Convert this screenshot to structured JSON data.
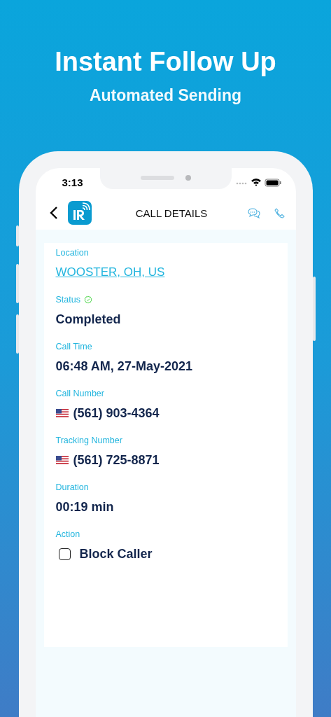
{
  "headline": "Instant Follow Up",
  "subheadline": "Automated Sending",
  "status_bar": {
    "time": "3:13"
  },
  "nav": {
    "title": "CALL DETAILS"
  },
  "fields": [
    {
      "kind": "link",
      "label": "Location",
      "value": "WOOSTER, OH, US"
    },
    {
      "kind": "status",
      "label": "Status",
      "value": "Completed"
    },
    {
      "kind": "text",
      "label": "Call Time",
      "value": "06:48 AM, 27-May-2021"
    },
    {
      "kind": "phone",
      "label": "Call Number",
      "value": "(561) 903-4364"
    },
    {
      "kind": "phone",
      "label": "Tracking Number",
      "value": "(561) 725-8871"
    },
    {
      "kind": "text",
      "label": "Duration",
      "value": "00:19 min"
    },
    {
      "kind": "checkbox",
      "label": "Action",
      "value": "Block Caller",
      "checked": false
    }
  ]
}
